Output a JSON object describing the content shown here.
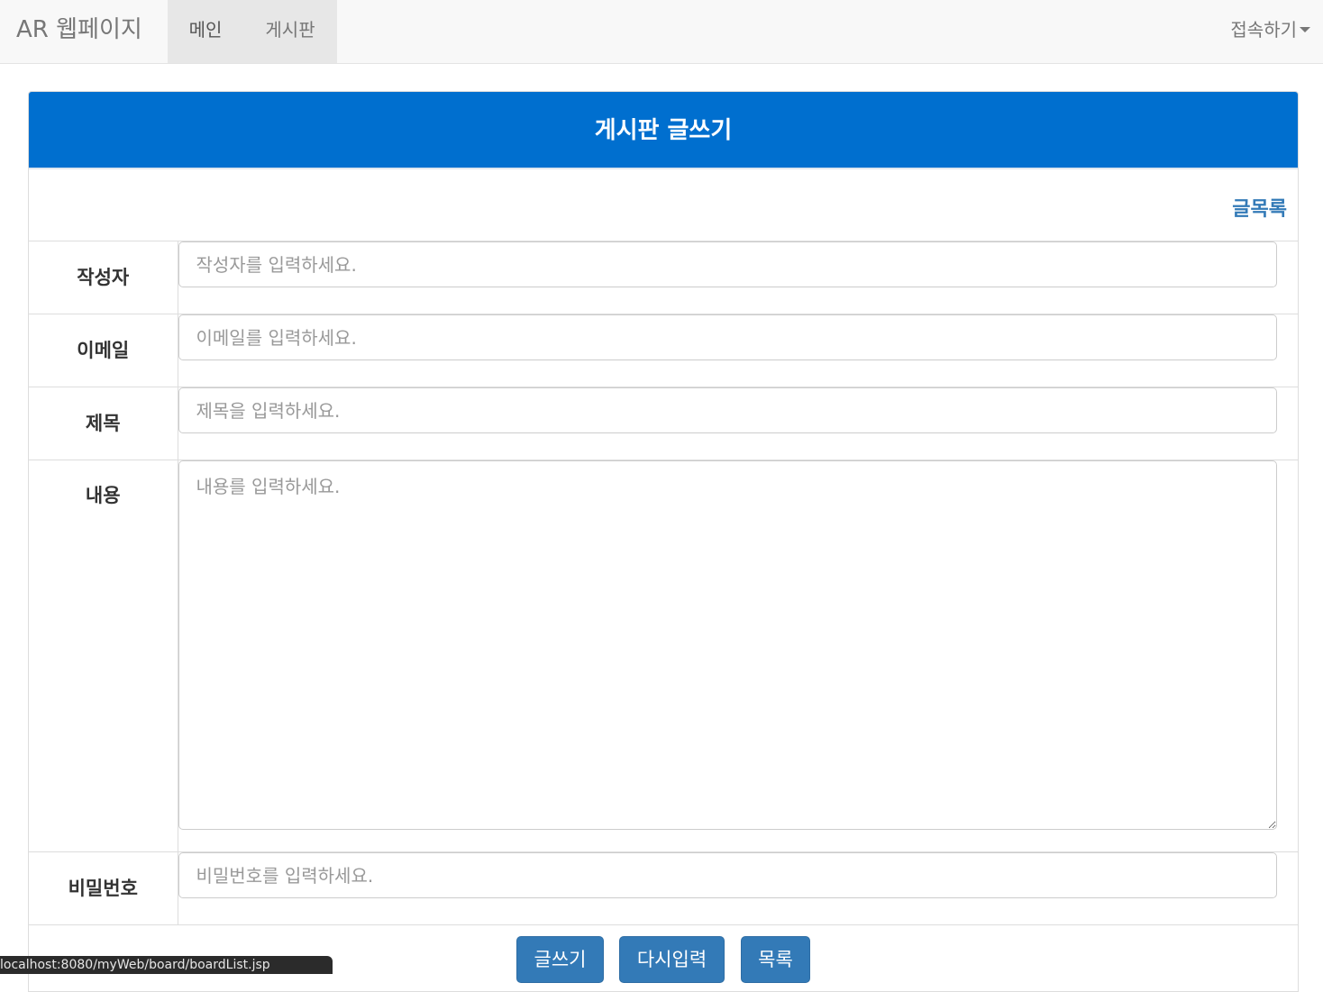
{
  "navbar": {
    "brand": "AR 웹페이지",
    "items": [
      {
        "label": "메인"
      },
      {
        "label": "게시판"
      }
    ],
    "connect_label": "접속하기"
  },
  "panel": {
    "title": "게시판 글쓰기",
    "list_link": "글목록"
  },
  "form": {
    "writer": {
      "label": "작성자",
      "placeholder": "작성자를 입력하세요."
    },
    "email": {
      "label": "이메일",
      "placeholder": "이메일를 입력하세요."
    },
    "subject": {
      "label": "제목",
      "placeholder": "제목을 입력하세요."
    },
    "content": {
      "label": "내용",
      "placeholder": "내용를 입력하세요."
    },
    "password": {
      "label": "비밀번호",
      "placeholder": "비밀번호를 입력하세요."
    }
  },
  "buttons": {
    "write": "글쓰기",
    "reset": "다시입력",
    "list": "목록"
  },
  "status_bar": {
    "url": "localhost:8080/myWeb/board/boardList.jsp"
  }
}
